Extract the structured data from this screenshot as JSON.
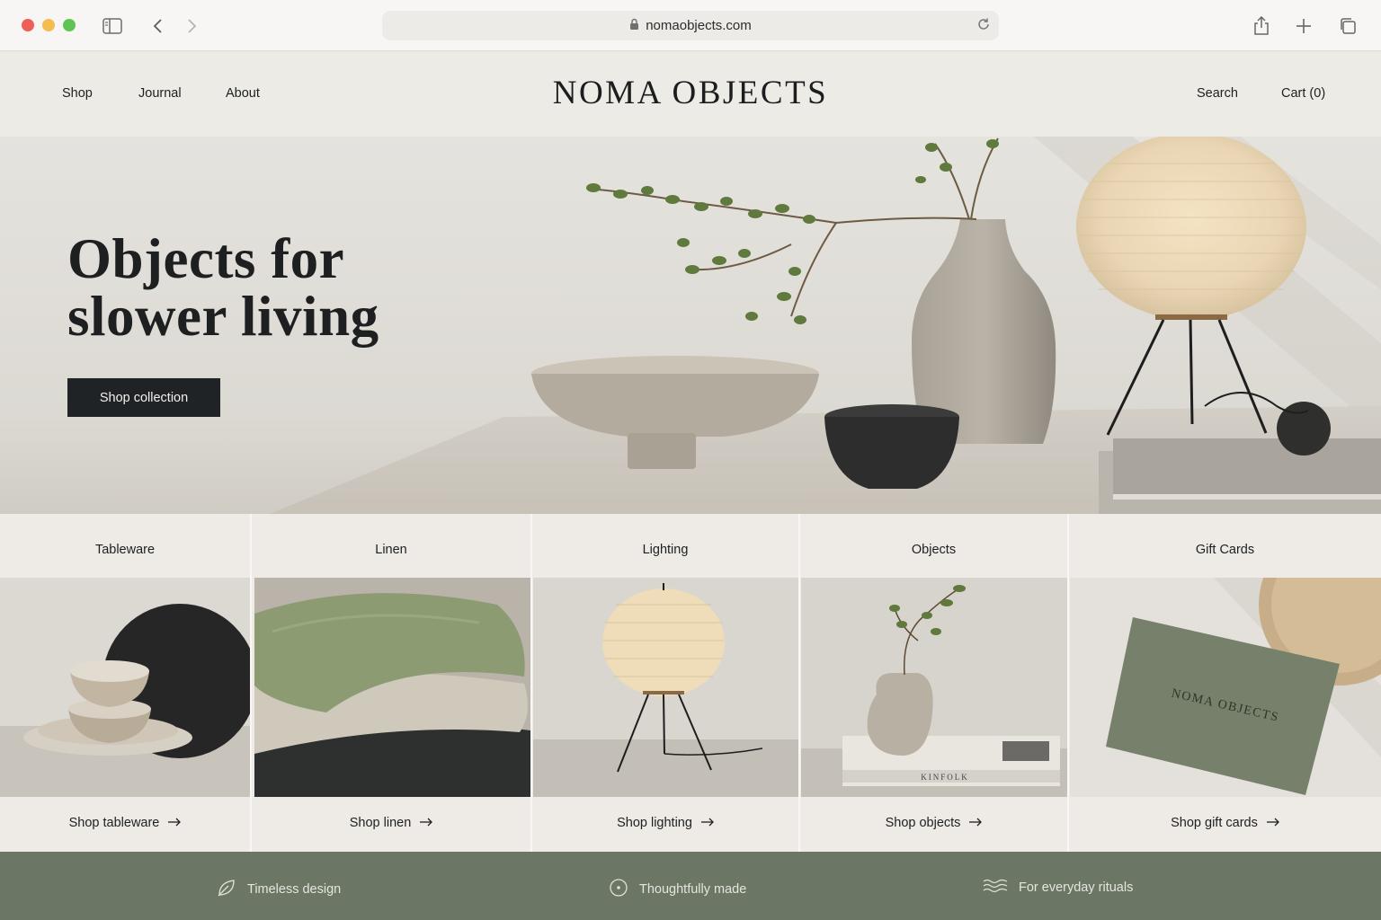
{
  "browser": {
    "url": "nomaobjects.com"
  },
  "header": {
    "nav_left": [
      "Shop",
      "Journal",
      "About"
    ],
    "brand": "NOMA OBJECTS",
    "search": "Search",
    "cart": "Cart (0)"
  },
  "hero": {
    "title_line1": "Objects for",
    "title_line2": "slower living",
    "cta": "Shop collection"
  },
  "categories": [
    {
      "title": "Tableware",
      "link": "Shop tableware"
    },
    {
      "title": "Linen",
      "link": "Shop linen"
    },
    {
      "title": "Lighting",
      "link": "Shop lighting"
    },
    {
      "title": "Objects",
      "link": "Shop objects"
    },
    {
      "title": "Gift Cards",
      "link": "Shop gift cards"
    }
  ],
  "images": {
    "book_spine": "KINFOLK",
    "gift_card_text": "NOMA OBJECTS"
  },
  "features": [
    {
      "label": "Timeless design",
      "icon": "leaf-icon"
    },
    {
      "label": "Thoughtfully made",
      "icon": "circle-dot-icon"
    },
    {
      "label": "For everyday rituals",
      "icon": "waves-icon"
    }
  ],
  "colors": {
    "background": "#ebe8e3",
    "dark_button": "#1f2326",
    "band": "#6b7664"
  }
}
